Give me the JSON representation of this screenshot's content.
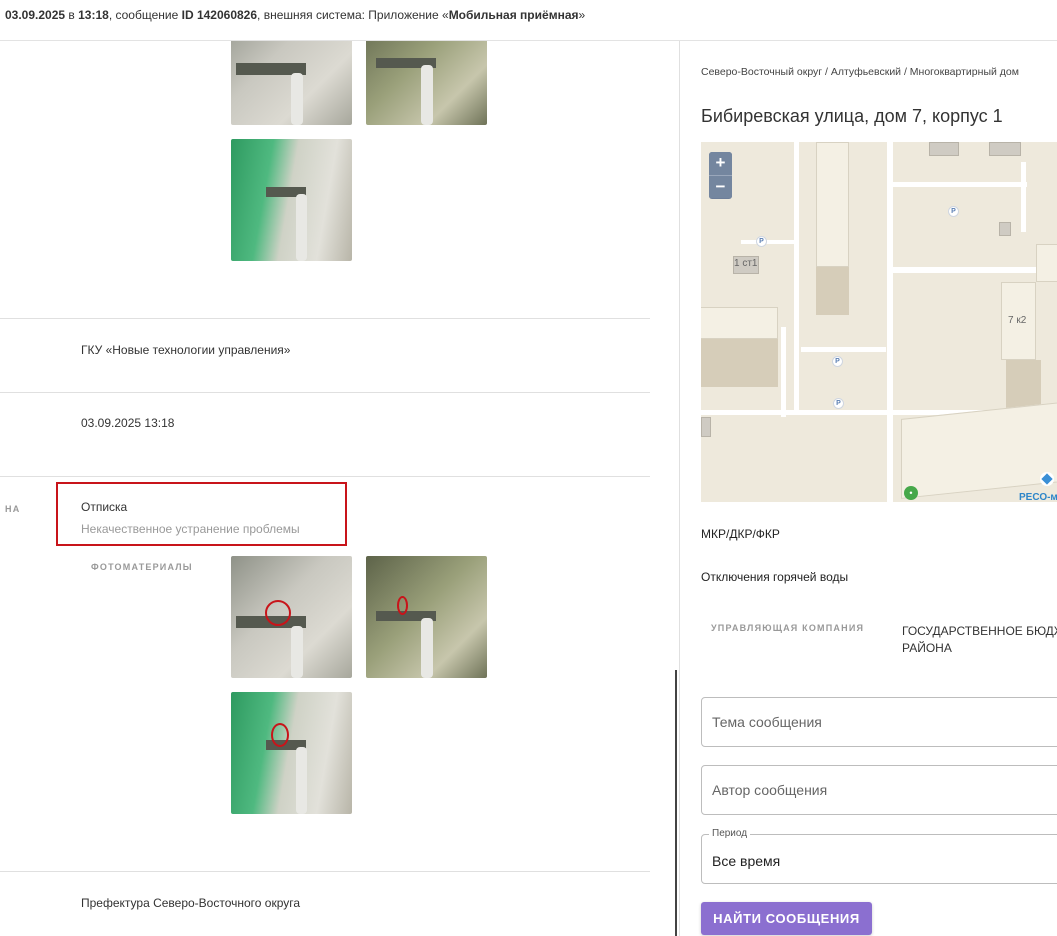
{
  "header": {
    "date_time": "03.09.2025",
    "in_word": "в",
    "time": "13:18",
    "message_prefix": ", сообщение",
    "id_label": "ID 142060826",
    "system_prefix": ", внешняя система: Приложение «",
    "system_name": "Мобильная приёмная",
    "system_suffix": "»"
  },
  "details": {
    "organization": "ГКУ «Новые технологии управления»",
    "datetime": "03.09.2025 13:18",
    "status_side_label": "НА",
    "status": "Отписка",
    "status_reason": "Некачественное устранение проблемы",
    "photos_label": "ФОТОМАТЕРИАЛЫ",
    "prefecture": "Префектура Северо-Восточного округа"
  },
  "location": {
    "breadcrumb": "Северо-Восточный округ / Алтуфьевский / Многоквартирный дом",
    "address": "Бибиревская улица, дом 7, корпус 1"
  },
  "map": {
    "zoom_in": "+",
    "zoom_out": "−",
    "label_1": "1 ст1",
    "label_2": "7 к2",
    "parking": "P",
    "brand": "РЕСО-м"
  },
  "info": {
    "programs": "МКР/ДКР/ФКР",
    "hot_water": "Отключения горячей воды",
    "mgmt_label": "УПРАВЛЯЮЩАЯ КОМПАНИЯ",
    "mgmt_value": "ГОСУДАРСТВЕННОЕ БЮДЖ АЛТУФЬЕВСКОГО РАЙОНА"
  },
  "search": {
    "topic_placeholder": "Тема сообщения",
    "author_placeholder": "Автор сообщения",
    "period_label": "Период",
    "period_value": "Все время",
    "find_button": "НАЙТИ СООБЩЕНИЯ"
  },
  "colors": {
    "accent": "#8b6fd0",
    "highlight_border": "#c8141a"
  },
  "icons": [
    "plus-icon",
    "minus-icon",
    "parking-icon",
    "cart-icon",
    "diamond-icon"
  ]
}
